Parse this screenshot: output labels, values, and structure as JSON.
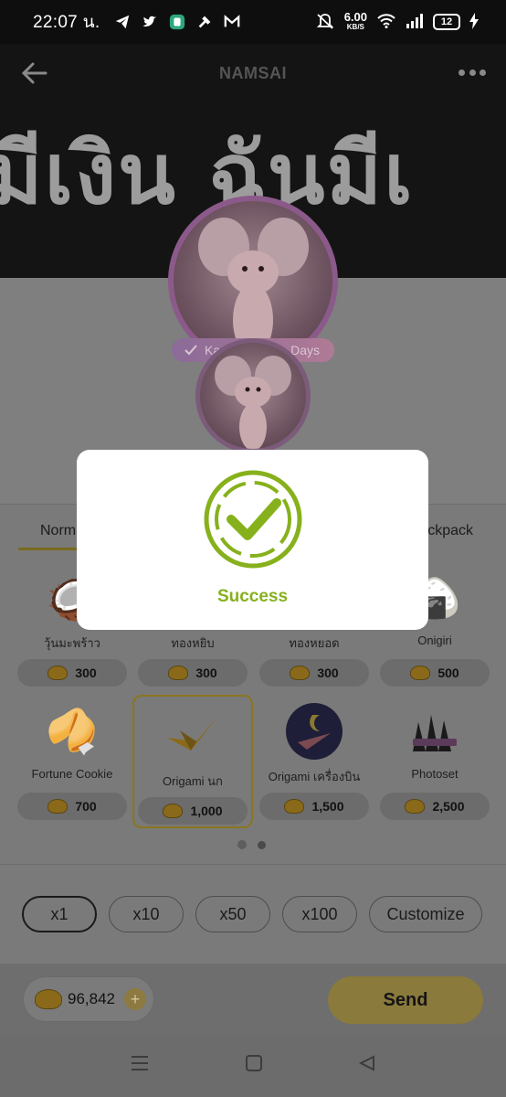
{
  "status_bar": {
    "time": "22:07 น.",
    "net_speed_value": "6.00",
    "net_speed_unit": "KB/S",
    "battery": "12",
    "icons": [
      "telegram-icon",
      "twitter-icon",
      "app-icon",
      "tools-icon",
      "gmail-icon",
      "mute-icon",
      "wifi-icon",
      "signal-icon",
      "battery-icon"
    ]
  },
  "header": {
    "title": "NAMSAI",
    "banner_text": "มีเงิน ฉันมีเ"
  },
  "profile": {
    "badge_left": "Ka",
    "badge_right": "Days"
  },
  "tabs": {
    "normal": "Norma",
    "backpack": "ckpack"
  },
  "gifts": [
    {
      "name": "วุ้นมะพร้าว",
      "price": "300",
      "icon": "coconut-jelly-icon"
    },
    {
      "name": "ทองหยิบ",
      "price": "300",
      "icon": "thong-yip-icon"
    },
    {
      "name": "ทองหยอด",
      "price": "300",
      "icon": "thong-yod-icon"
    },
    {
      "name": "Onigiri",
      "price": "500",
      "icon": "onigiri-icon"
    },
    {
      "name": "Fortune Cookie",
      "price": "700",
      "icon": "fortune-cookie-icon"
    },
    {
      "name": "Origami นก",
      "price": "1,000",
      "icon": "origami-bird-icon"
    },
    {
      "name": "Origami เครื่องบิน",
      "price": "1,500",
      "icon": "origami-plane-icon"
    },
    {
      "name": "Photoset",
      "price": "2,500",
      "icon": "photoset-icon"
    }
  ],
  "multipliers": [
    "x1",
    "x10",
    "x50",
    "x100",
    "Customize"
  ],
  "balance": "96,842",
  "send_label": "Send",
  "dialog": {
    "message": "Success",
    "accent": "#86b11c"
  }
}
